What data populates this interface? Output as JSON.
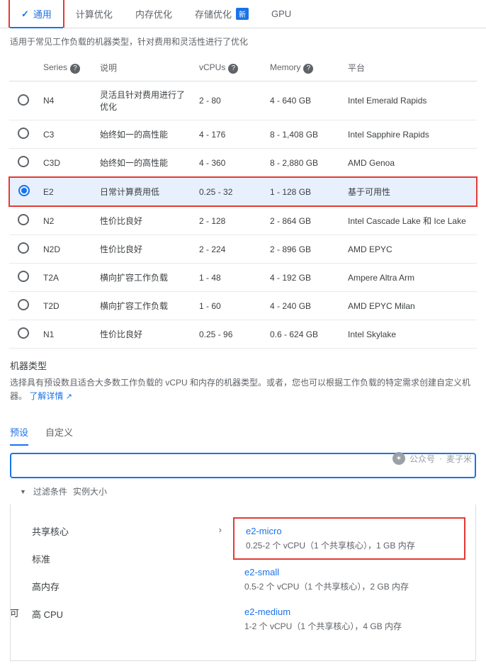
{
  "tabs": {
    "general": "通用",
    "compute_opt": "计算优化",
    "memory_opt": "内存优化",
    "storage_opt": "存储优化",
    "new_badge": "新",
    "gpu": "GPU"
  },
  "description": "适用于常见工作负载的机器类型，针对费用和灵活性进行了优化",
  "table": {
    "headers": {
      "series": "Series",
      "desc": "说明",
      "vcpus": "vCPUs",
      "memory": "Memory",
      "platform": "平台"
    },
    "rows": [
      {
        "series": "N4",
        "desc": "灵活且针对费用进行了优化",
        "vcpus": "2 - 80",
        "memory": "4 - 640 GB",
        "platform": "Intel Emerald Rapids",
        "selected": false
      },
      {
        "series": "C3",
        "desc": "始终如一的高性能",
        "vcpus": "4 - 176",
        "memory": "8 - 1,408 GB",
        "platform": "Intel Sapphire Rapids",
        "selected": false
      },
      {
        "series": "C3D",
        "desc": "始终如一的高性能",
        "vcpus": "4 - 360",
        "memory": "8 - 2,880 GB",
        "platform": "AMD Genoa",
        "selected": false
      },
      {
        "series": "E2",
        "desc": "日常计算费用低",
        "vcpus": "0.25 - 32",
        "memory": "1 - 128 GB",
        "platform": "基于可用性",
        "selected": true
      },
      {
        "series": "N2",
        "desc": "性价比良好",
        "vcpus": "2 - 128",
        "memory": "2 - 864 GB",
        "platform": "Intel Cascade Lake 和 Ice Lake",
        "selected": false
      },
      {
        "series": "N2D",
        "desc": "性价比良好",
        "vcpus": "2 - 224",
        "memory": "2 - 896 GB",
        "platform": "AMD EPYC",
        "selected": false
      },
      {
        "series": "T2A",
        "desc": "横向扩容工作负载",
        "vcpus": "1 - 48",
        "memory": "4 - 192 GB",
        "platform": "Ampere Altra Arm",
        "selected": false
      },
      {
        "series": "T2D",
        "desc": "横向扩容工作负载",
        "vcpus": "1 - 60",
        "memory": "4 - 240 GB",
        "platform": "AMD EPYC Milan",
        "selected": false
      },
      {
        "series": "N1",
        "desc": "性价比良好",
        "vcpus": "0.25 - 96",
        "memory": "0.6 - 624 GB",
        "platform": "Intel Skylake",
        "selected": false
      }
    ]
  },
  "machine_type": {
    "title": "机器类型",
    "sub": "选择具有预设数且适合大多数工作负载的 vCPU 和内存的机器类型。或者，您也可以根据工作负载的特定需求创建自定义机器。",
    "learn_more": "了解详情"
  },
  "subtabs": {
    "preset": "预设",
    "custom": "自定义"
  },
  "filter": {
    "label": "过滤条件",
    "value": "实例大小"
  },
  "left_label": "可",
  "categories": {
    "shared": "共享核心",
    "standard": "标准",
    "highmem": "高内存",
    "highcpu": "高 CPU"
  },
  "options": [
    {
      "name": "e2-micro",
      "sub": "0.25-2 个 vCPU（1 个共享核心），1 GB 内存",
      "hl": true
    },
    {
      "name": "e2-small",
      "sub": "0.5-2 个 vCPU（1 个共享核心），2 GB 内存",
      "hl": false
    },
    {
      "name": "e2-medium",
      "sub": "1-2 个 vCPU（1 个共享核心），4 GB 内存",
      "hl": false
    }
  ],
  "watermark": {
    "prefix": "公众号",
    "dot": "·",
    "name": "麦子米"
  }
}
